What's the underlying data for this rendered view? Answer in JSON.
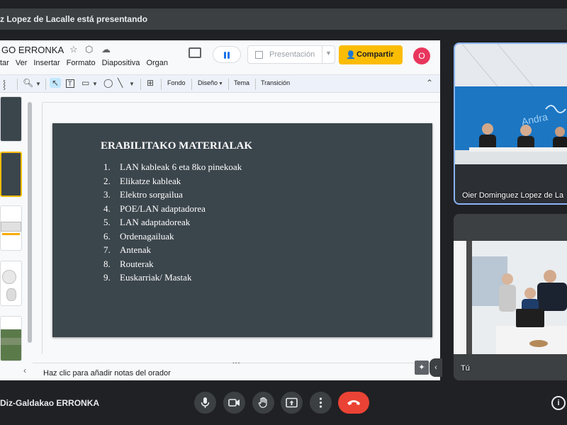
{
  "presenting_banner": "z Lopez de Lacalle está presentando",
  "doc": {
    "title": "GO ERRONKA",
    "menu": [
      "tar",
      "Ver",
      "Insertar",
      "Formato",
      "Diapositiva",
      "Organ"
    ],
    "present_label": "Presentación",
    "share_label": "Compartir",
    "avatar_letter": "O"
  },
  "toolbar": {
    "background": "Fondo",
    "layout": "Diseño",
    "theme": "Tema",
    "transition": "Transición"
  },
  "slide": {
    "title": "ERABILITAKO MATERIALAK",
    "items": [
      {
        "num": "1.",
        "text": "LAN kableak 6 eta 8ko pinekoak"
      },
      {
        "num": "2.",
        "text": "Elikatze kableak"
      },
      {
        "num": "3.",
        "text": "Elektro sorgailua"
      },
      {
        "num": "4.",
        "text": "POE/LAN  adaptadorea"
      },
      {
        "num": "5.",
        "text": "LAN adaptadoreak"
      },
      {
        "num": "6.",
        "text": "Ordenagailuak"
      },
      {
        "num": "7.",
        "text": "Antenak"
      },
      {
        "num": "8.",
        "text": "Routerak"
      },
      {
        "num": "9.",
        "text": "Euskarriak/ Mastak"
      }
    ]
  },
  "notes_placeholder": "Haz clic para añadir notas del orador",
  "participants": [
    {
      "name": "Oier Dominguez Lopez de La"
    },
    {
      "name": "Tú"
    }
  ],
  "meeting_name": "Diz-Galdakao ERRONKA",
  "colors": {
    "meet_bg": "#202124",
    "slide_bg": "#3b454c",
    "share_button": "#fbbc04",
    "leave_button": "#ea4335",
    "active_speaker_border": "#8ab4f8"
  }
}
